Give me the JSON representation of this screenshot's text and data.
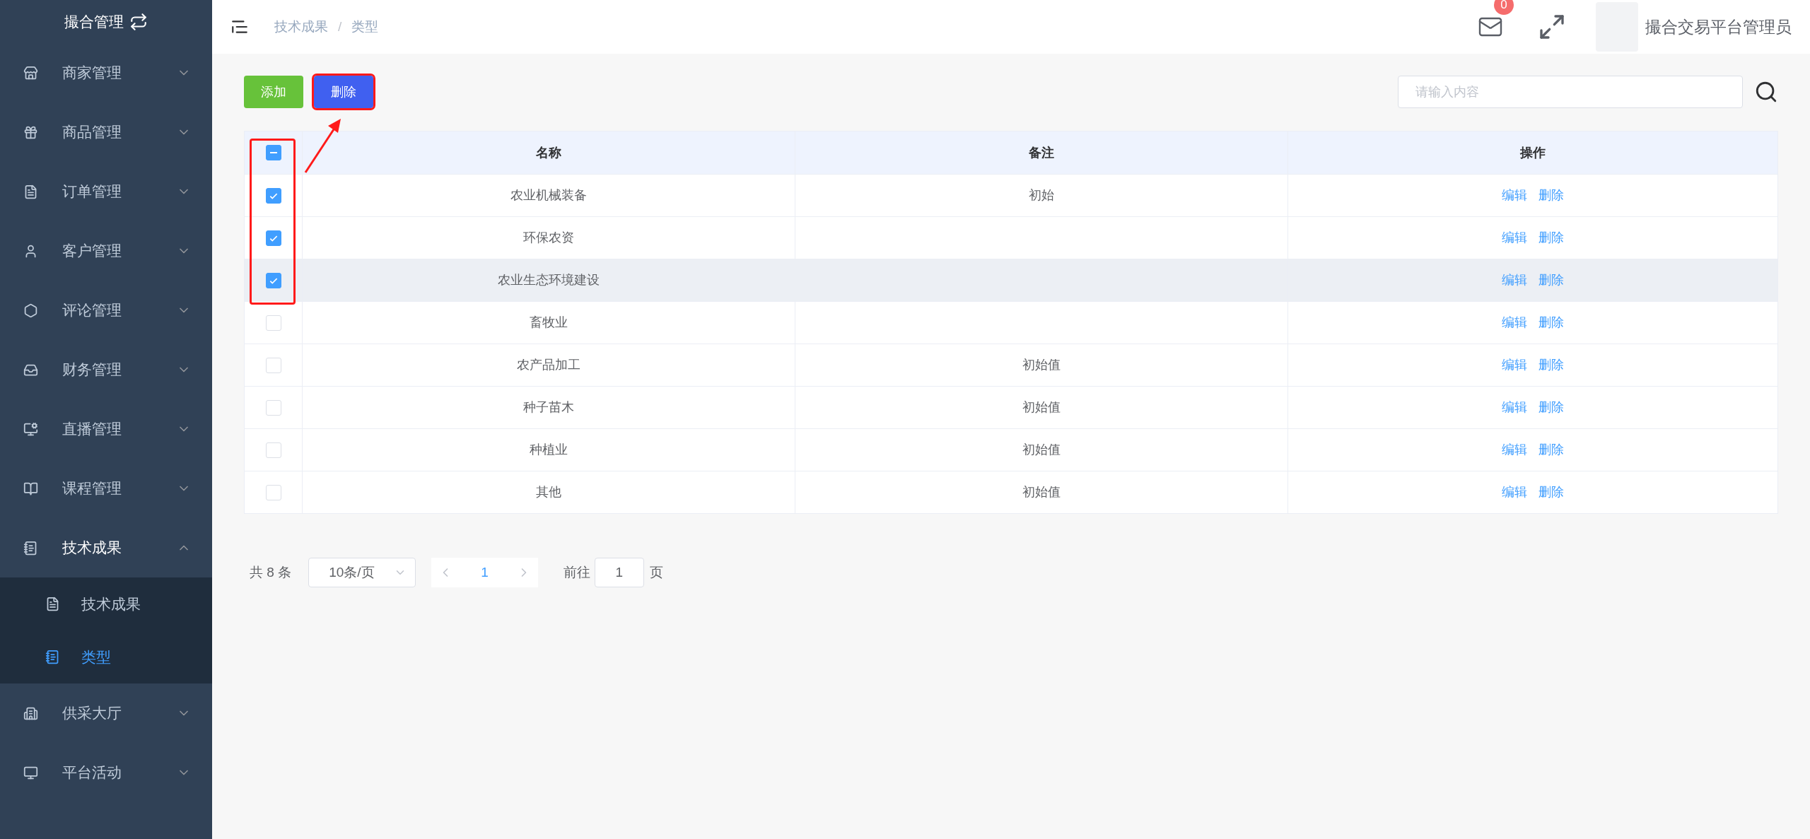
{
  "sidebar": {
    "title": "撮合管理",
    "items": [
      {
        "label": "商家管理",
        "expanded": false
      },
      {
        "label": "商品管理",
        "expanded": false
      },
      {
        "label": "订单管理",
        "expanded": false
      },
      {
        "label": "客户管理",
        "expanded": false
      },
      {
        "label": "评论管理",
        "expanded": false
      },
      {
        "label": "财务管理",
        "expanded": false
      },
      {
        "label": "直播管理",
        "expanded": false
      },
      {
        "label": "课程管理",
        "expanded": false
      },
      {
        "label": "技术成果",
        "expanded": true,
        "children": [
          {
            "label": "技术成果",
            "selected": false
          },
          {
            "label": "类型",
            "selected": true
          }
        ]
      },
      {
        "label": "供采大厅",
        "expanded": false
      },
      {
        "label": "平台活动",
        "expanded": false
      }
    ]
  },
  "header": {
    "breadcrumb": [
      "技术成果",
      "类型"
    ],
    "breadcrumb_separator": "/",
    "mail_count": "0",
    "user_name": "撮合交易平台管理员"
  },
  "toolbar": {
    "buttons": [
      {
        "label": "添加",
        "kind": "add",
        "highlighted": false
      },
      {
        "label": "删除",
        "kind": "delete",
        "highlighted": true
      }
    ],
    "search": {
      "placeholder": "请输入内容"
    }
  },
  "table": {
    "select_all": {
      "indeterminate": true
    },
    "columns": [
      "名称",
      "备注",
      "操作"
    ],
    "selection_highlighted": true,
    "rows": [
      {
        "checked": true,
        "name": "农业机械装备",
        "remark": "初始",
        "hovered": false,
        "actions": [
          "编辑",
          "删除"
        ]
      },
      {
        "checked": true,
        "name": "环保农资",
        "hovered": false,
        "actions": [
          "编辑",
          "删除"
        ]
      },
      {
        "checked": true,
        "name": "农业生态环境建设",
        "hovered": true,
        "actions": [
          "编辑",
          "删除"
        ]
      },
      {
        "checked": false,
        "name": "畜牧业",
        "hovered": false,
        "actions": [
          "编辑",
          "删除"
        ]
      },
      {
        "checked": false,
        "name": "农产品加工",
        "remark": "初始值",
        "hovered": false,
        "actions": [
          "编辑",
          "删除"
        ]
      },
      {
        "checked": false,
        "name": "种子苗木",
        "remark": "初始值",
        "hovered": false,
        "actions": [
          "编辑",
          "删除"
        ]
      },
      {
        "checked": false,
        "name": "种植业",
        "remark": "初始值",
        "hovered": false,
        "actions": [
          "编辑",
          "删除"
        ]
      },
      {
        "checked": false,
        "name": "其他",
        "remark": "初始值",
        "hovered": false,
        "actions": [
          "编辑",
          "删除"
        ]
      }
    ]
  },
  "pagination": {
    "total": "共 8 条",
    "page_size": "10条/页",
    "pages": [
      {
        "label": "1",
        "selected": true
      }
    ],
    "goto_label": "前往",
    "goto_value": "1",
    "page_unit": "页"
  }
}
